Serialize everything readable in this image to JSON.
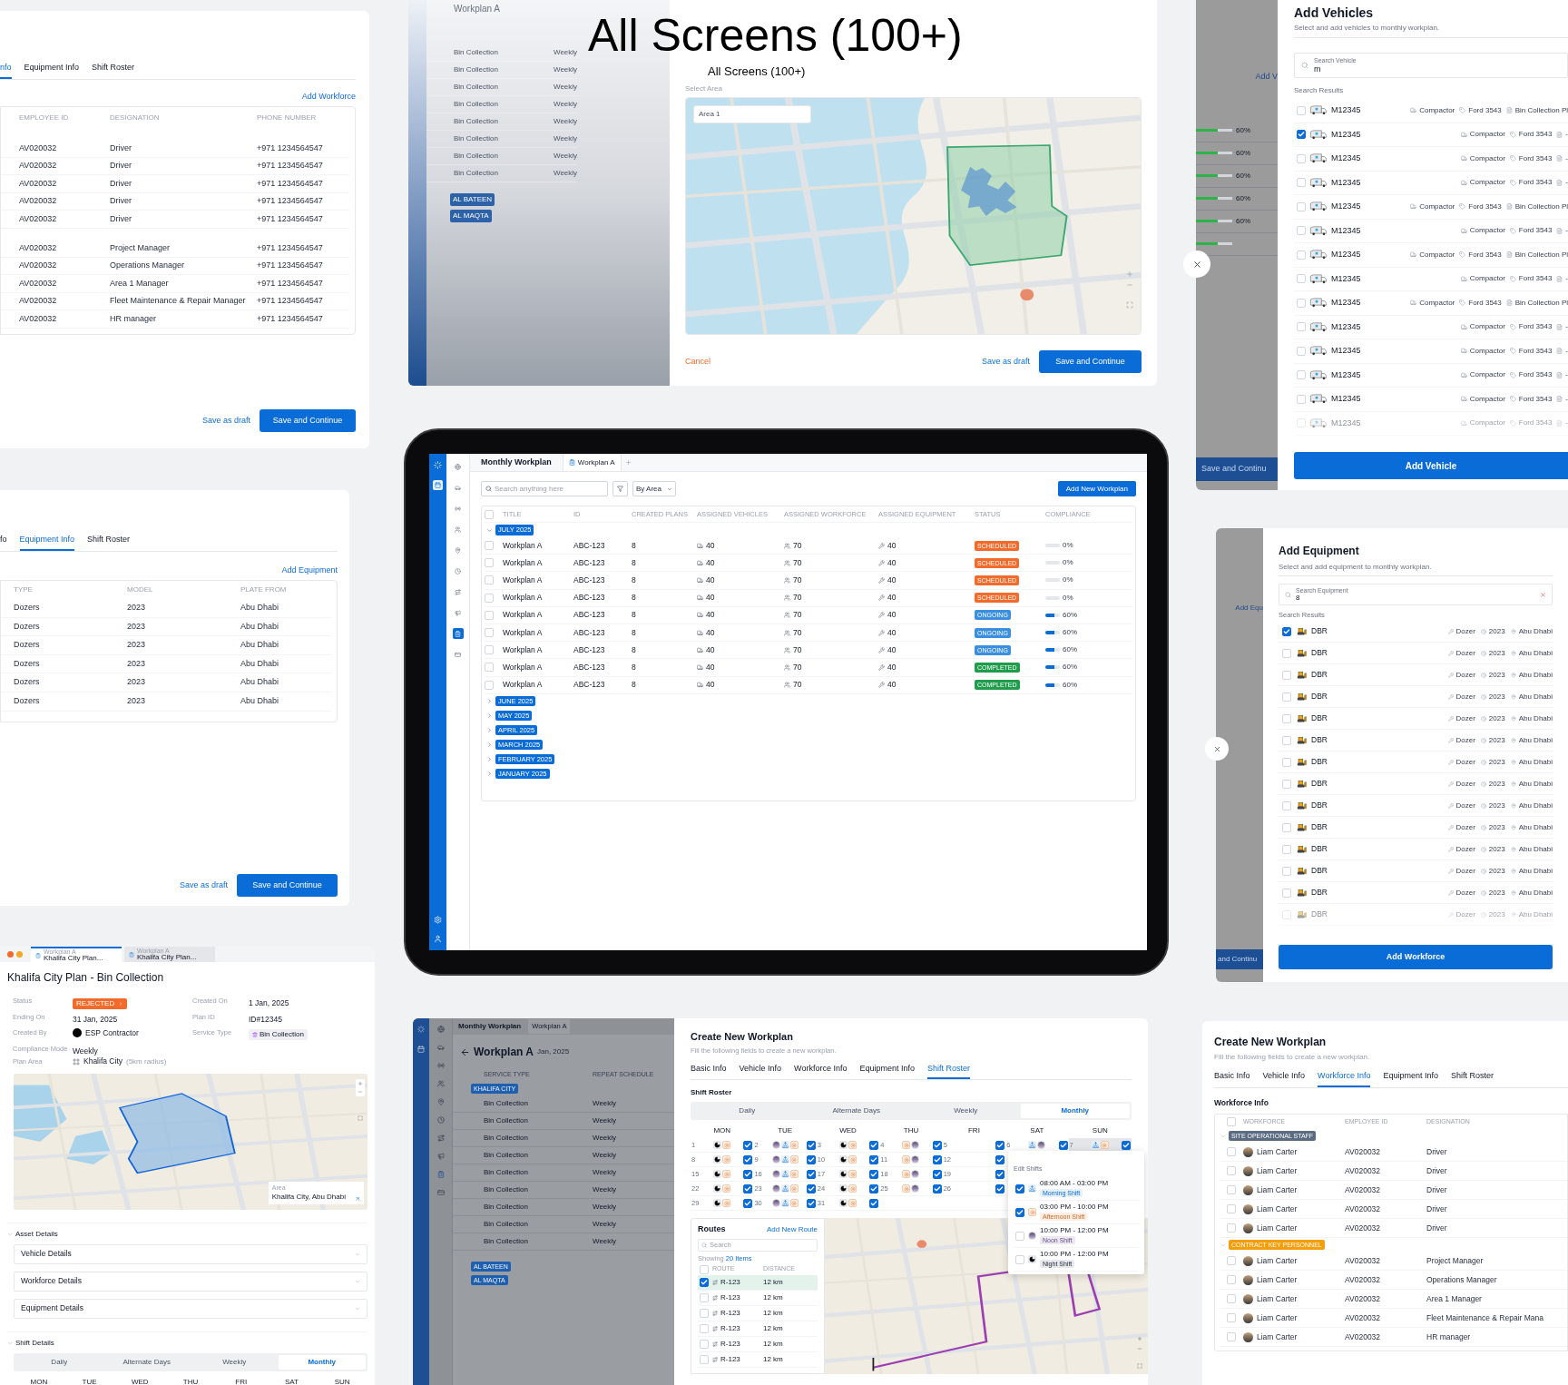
{
  "headline": {
    "title": "All Screens (100+)",
    "subtitle": "All Screens (100+)"
  },
  "workforce_table": {
    "tabs": [
      {
        "label": "nfo",
        "selected": true
      },
      {
        "label": "Equipment Info",
        "selected": false
      },
      {
        "label": "Shift Roster",
        "selected": false
      }
    ],
    "action": "Add Workforce",
    "columns": [
      "EMPLOYEE ID",
      "DESIGNATION",
      "PHONE NUMBER"
    ],
    "groups": [
      [
        {
          "id": "AV020032",
          "designation": "Driver",
          "phone": "+971 1234564547"
        },
        {
          "id": "AV020032",
          "designation": "Driver",
          "phone": "+971 1234564547"
        },
        {
          "id": "AV020032",
          "designation": "Driver",
          "phone": "+971 1234564547"
        },
        {
          "id": "AV020032",
          "designation": "Driver",
          "phone": "+971 1234564547"
        },
        {
          "id": "AV020032",
          "designation": "Driver",
          "phone": "+971 1234564547"
        }
      ],
      [
        {
          "id": "AV020032",
          "designation": "Project Manager",
          "phone": "+971 1234564547"
        },
        {
          "id": "AV020032",
          "designation": "Operations Manager",
          "phone": "+971 1234564547"
        },
        {
          "id": "AV020032",
          "designation": "Area 1 Manager",
          "phone": "+971 1234564547"
        },
        {
          "id": "AV020032",
          "designation": "Fleet Maintenance & Repair Manager",
          "phone": "+971 1234564547"
        },
        {
          "id": "AV020032",
          "designation": "HR manager",
          "phone": "+971 1234564547"
        }
      ]
    ],
    "draft": "Save as draft",
    "submit": "Save and Continue"
  },
  "area_screen": {
    "heading": "Workplan A",
    "list": [
      {
        "title": "Bin Collection",
        "frequency": "Weekly"
      },
      {
        "title": "Bin Collection",
        "frequency": "Weekly"
      },
      {
        "title": "Bin Collection",
        "frequency": "Weekly"
      },
      {
        "title": "Bin Collection",
        "frequency": "Weekly"
      },
      {
        "title": "Bin Collection",
        "frequency": "Weekly"
      },
      {
        "title": "Bin Collection",
        "frequency": "Weekly"
      },
      {
        "title": "Bin Collection",
        "frequency": "Weekly"
      },
      {
        "title": "Bin Collection",
        "frequency": "Weekly"
      }
    ],
    "groups": [
      "AL BATEEN",
      "AL MAQTA"
    ],
    "field_label": "Select Area",
    "field_value": "Area 1",
    "cancel": "Cancel",
    "draft": "Save as draft",
    "submit": "Save and Continue"
  },
  "add_vehicles": {
    "title": "Add Vehicles",
    "subtitle": "Select and add vehicles to monthly workplan.",
    "search": {
      "label": "Search Vehicle",
      "value": "m"
    },
    "results_label": "Search Results",
    "rows": [
      {
        "plate": "M12345",
        "checked": false,
        "faded": false,
        "type": "Compactor",
        "model": "Ford 3543",
        "plan": "Bin Collection Pl"
      },
      {
        "plate": "M12345",
        "checked": true,
        "faded": false,
        "type": "Compactor",
        "model": "Ford 3543",
        "plan": "-"
      },
      {
        "plate": "M12345",
        "checked": false,
        "faded": false,
        "type": "Compactor",
        "model": "Ford 3543",
        "plan": "-"
      },
      {
        "plate": "M12345",
        "checked": false,
        "faded": false,
        "type": "Compactor",
        "model": "Ford 3543",
        "plan": "-"
      },
      {
        "plate": "M12345",
        "checked": false,
        "faded": false,
        "type": "Compactor",
        "model": "Ford 3543",
        "plan": "Bin Collection Pl"
      },
      {
        "plate": "M12345",
        "checked": false,
        "faded": false,
        "type": "Compactor",
        "model": "Ford 3543",
        "plan": "-"
      },
      {
        "plate": "M12345",
        "checked": false,
        "faded": false,
        "type": "Compactor",
        "model": "Ford 3543",
        "plan": "Bin Collection Pl"
      },
      {
        "plate": "M12345",
        "checked": false,
        "faded": false,
        "type": "Compactor",
        "model": "Ford 3543",
        "plan": "-"
      },
      {
        "plate": "M12345",
        "checked": false,
        "faded": false,
        "type": "Compactor",
        "model": "Ford 3543",
        "plan": "Bin Collection Pl"
      },
      {
        "plate": "M12345",
        "checked": false,
        "faded": false,
        "type": "Compactor",
        "model": "Ford 3543",
        "plan": "-"
      },
      {
        "plate": "M12345",
        "checked": false,
        "faded": false,
        "type": "Compactor",
        "model": "Ford 3543",
        "plan": "-"
      },
      {
        "plate": "M12345",
        "checked": false,
        "faded": false,
        "type": "Compactor",
        "model": "Ford 3543",
        "plan": "-"
      },
      {
        "plate": "M12345",
        "checked": false,
        "faded": false,
        "type": "Compactor",
        "model": "Ford 3543",
        "plan": "-"
      },
      {
        "plate": "M12345",
        "checked": false,
        "faded": true,
        "type": "Compactor",
        "model": "Ford 3543",
        "plan": "-"
      }
    ],
    "button": "Add Vehicle",
    "behind": {
      "link": "Add V",
      "bars": [
        {
          "level": 0.6,
          "reading": "60%"
        },
        {
          "level": 0.6,
          "reading": "60%"
        },
        {
          "level": 0.6,
          "reading": "60%"
        },
        {
          "level": 0.6,
          "reading": "60%"
        },
        {
          "level": 0.6,
          "reading": "60%"
        },
        {
          "level": 0.6
        }
      ],
      "button": "Save and Continu"
    }
  },
  "equipment_table": {
    "tabs": [
      {
        "label": "fo",
        "selected": false
      },
      {
        "label": "Equipment Info",
        "selected": true
      },
      {
        "label": "Shift Roster",
        "selected": false
      }
    ],
    "action": "Add Equipment",
    "columns": [
      "TYPE",
      "MODEL",
      "PLATE FROM"
    ],
    "rows": [
      {
        "type": "Dozers",
        "model": "2023",
        "plate": "Abu Dhabi"
      },
      {
        "type": "Dozers",
        "model": "2023",
        "plate": "Abu Dhabi"
      },
      {
        "type": "Dozers",
        "model": "2023",
        "plate": "Abu Dhabi"
      },
      {
        "type": "Dozers",
        "model": "2023",
        "plate": "Abu Dhabi"
      },
      {
        "type": "Dozers",
        "model": "2023",
        "plate": "Abu Dhabi"
      },
      {
        "type": "Dozers",
        "model": "2023",
        "plate": "Abu Dhabi"
      }
    ],
    "draft": "Save as draft",
    "submit": "Save and Continue"
  },
  "tablet": {
    "tabs": [
      {
        "label": "Monthly Workplan",
        "selected": false
      },
      {
        "label": "Workplan A",
        "selected": true
      }
    ],
    "search_placeholder": "Search anything here",
    "filter": "By Area",
    "button": "Add New Workplan",
    "all_checked": false,
    "columns": [
      "TITLE",
      "ID",
      "CREATED PLANS",
      "ASSIGNED VEHICLES",
      "ASSIGNED WORKFORCE",
      "ASSIGNED EQUIPMENT",
      "STATUS",
      "COMPLIANCE"
    ],
    "groups": [
      {
        "label": "JULY 2025",
        "expanded": true,
        "rows": [
          {
            "checked": false,
            "title": "Workplan A",
            "id": "ABC-123",
            "plans": "8",
            "vehicles": "40",
            "workforce": "70",
            "equipment": "40",
            "status": "SCHEDULED",
            "kind": "scheduled",
            "compliance": "0%",
            "level": 0
          },
          {
            "checked": false,
            "title": "Workplan A",
            "id": "ABC-123",
            "plans": "8",
            "vehicles": "40",
            "workforce": "70",
            "equipment": "40",
            "status": "SCHEDULED",
            "kind": "scheduled",
            "compliance": "0%",
            "level": 0
          },
          {
            "checked": false,
            "title": "Workplan A",
            "id": "ABC-123",
            "plans": "8",
            "vehicles": "40",
            "workforce": "70",
            "equipment": "40",
            "status": "SCHEDULED",
            "kind": "scheduled",
            "compliance": "0%",
            "level": 0
          },
          {
            "checked": false,
            "title": "Workplan A",
            "id": "ABC-123",
            "plans": "8",
            "vehicles": "40",
            "workforce": "70",
            "equipment": "40",
            "status": "SCHEDULED",
            "kind": "scheduled",
            "compliance": "0%",
            "level": 0
          },
          {
            "checked": false,
            "title": "Workplan A",
            "id": "ABC-123",
            "plans": "8",
            "vehicles": "40",
            "workforce": "70",
            "equipment": "40",
            "status": "ONGOING",
            "kind": "ongoing",
            "compliance": "60%",
            "level": 0.6
          },
          {
            "checked": false,
            "title": "Workplan A",
            "id": "ABC-123",
            "plans": "8",
            "vehicles": "40",
            "workforce": "70",
            "equipment": "40",
            "status": "ONGOING",
            "kind": "ongoing",
            "compliance": "60%",
            "level": 0.6
          },
          {
            "checked": false,
            "title": "Workplan A",
            "id": "ABC-123",
            "plans": "8",
            "vehicles": "40",
            "workforce": "70",
            "equipment": "40",
            "status": "ONGOING",
            "kind": "ongoing",
            "compliance": "60%",
            "level": 0.6
          },
          {
            "checked": false,
            "title": "Workplan A",
            "id": "ABC-123",
            "plans": "8",
            "vehicles": "40",
            "workforce": "70",
            "equipment": "40",
            "status": "COMPLETED",
            "kind": "completed",
            "compliance": "60%",
            "level": 0.6
          },
          {
            "checked": false,
            "title": "Workplan A",
            "id": "ABC-123",
            "plans": "8",
            "vehicles": "40",
            "workforce": "70",
            "equipment": "40",
            "status": "COMPLETED",
            "kind": "completed",
            "compliance": "60%",
            "level": 0.6
          }
        ]
      },
      {
        "label": "JUNE 2025",
        "expanded": false
      },
      {
        "label": "MAY 2025",
        "expanded": false
      },
      {
        "label": "APRIL 2025",
        "expanded": false
      },
      {
        "label": "MARCH 2025",
        "expanded": false
      },
      {
        "label": "FEBRUARY 2025",
        "expanded": false
      },
      {
        "label": "JANUARY 2025",
        "expanded": false
      }
    ]
  },
  "add_equipment": {
    "title": "Add Equipment",
    "subtitle": "Select and add equipment to monthly workplan.",
    "search": {
      "label": "Search Equipment",
      "value": "8"
    },
    "results_label": "Search Results",
    "rows": [
      {
        "name": "DBR",
        "checked": true,
        "faded": false,
        "type": "Dozer",
        "model": "2023",
        "location": "Abu Dhabi"
      },
      {
        "name": "DBR",
        "checked": false,
        "faded": false,
        "type": "Dozer",
        "model": "2023",
        "location": "Abu Dhabi"
      },
      {
        "name": "DBR",
        "checked": false,
        "faded": false,
        "type": "Dozer",
        "model": "2023",
        "location": "Abu Dhabi"
      },
      {
        "name": "DBR",
        "checked": false,
        "faded": false,
        "type": "Dozer",
        "model": "2023",
        "location": "Abu Dhabi"
      },
      {
        "name": "DBR",
        "checked": false,
        "faded": false,
        "type": "Dozer",
        "model": "2023",
        "location": "Abu Dhabi"
      },
      {
        "name": "DBR",
        "checked": false,
        "faded": false,
        "type": "Dozer",
        "model": "2023",
        "location": "Abu Dhabi"
      },
      {
        "name": "DBR",
        "checked": false,
        "faded": false,
        "type": "Dozer",
        "model": "2023",
        "location": "Abu Dhabi"
      },
      {
        "name": "DBR",
        "checked": false,
        "faded": false,
        "type": "Dozer",
        "model": "2023",
        "location": "Abu Dhabi"
      },
      {
        "name": "DBR",
        "checked": false,
        "faded": false,
        "type": "Dozer",
        "model": "2023",
        "location": "Abu Dhabi"
      },
      {
        "name": "DBR",
        "checked": false,
        "faded": false,
        "type": "Dozer",
        "model": "2023",
        "location": "Abu Dhabi"
      },
      {
        "name": "DBR",
        "checked": false,
        "faded": false,
        "type": "Dozer",
        "model": "2023",
        "location": "Abu Dhabi"
      },
      {
        "name": "DBR",
        "checked": false,
        "faded": false,
        "type": "Dozer",
        "model": "2023",
        "location": "Abu Dhabi"
      },
      {
        "name": "DBR",
        "checked": false,
        "faded": false,
        "type": "Dozer",
        "model": "2023",
        "location": "Abu Dhabi"
      },
      {
        "name": "DBR",
        "checked": false,
        "faded": true,
        "type": "Dozer",
        "model": "2023",
        "location": "Abu Dhabi"
      }
    ],
    "button": "Add Workforce",
    "behind": {
      "link": "Add Equ",
      "button": "and Continu"
    }
  },
  "plan_detail": {
    "window_tabs": [
      {
        "caption": "Workplan A",
        "label": "Khalifa City Plan...",
        "selected": true
      },
      {
        "caption": "Workplan A",
        "label": "Khalifa City Plan...",
        "selected": false
      }
    ],
    "title": "Khalifa City Plan - Bin Collection",
    "field_rows": [
      [
        {
          "label": "Status",
          "kind": "badge",
          "value": "REJECTED"
        },
        {
          "label": "Created On",
          "kind": "text",
          "value": "1 Jan, 2025"
        }
      ],
      [
        {
          "label": "Ending On",
          "kind": "text",
          "value": "31 Jan, 2025"
        },
        {
          "label": "Plan ID",
          "kind": "text",
          "value": "ID#12345"
        }
      ],
      [
        {
          "label": "Created By",
          "kind": "avatar",
          "value": "ESP Contractor"
        },
        {
          "label": "Service Type",
          "kind": "tag",
          "value": "Bin Collection"
        }
      ],
      [
        {
          "label": "Compliance Mode",
          "kind": "text",
          "value": "Weekly"
        }
      ],
      [
        {
          "label": "Plan Area",
          "kind": "area",
          "value": "Khalifa City",
          "note": "(5km radius)"
        }
      ]
    ],
    "map_card": {
      "label": "Area",
      "value": "Khalifa City, Abu Dhabi"
    },
    "asset_section": "Asset Details",
    "accordions": [
      "Vehicle Details",
      "Workforce Details",
      "Equipment Details"
    ],
    "shift_section": "Shift Details",
    "frequency": [
      {
        "label": "Daily",
        "selected": false
      },
      {
        "label": "Alternate Days",
        "selected": false
      },
      {
        "label": "Weekly",
        "selected": false
      },
      {
        "label": "Monthly",
        "selected": true
      }
    ],
    "days": [
      "MON",
      "TUE",
      "WED",
      "THU",
      "FRI",
      "SAT",
      "SUN"
    ]
  },
  "roster_screen": {
    "back": {
      "tab": "Monthly Workplan",
      "subtab": "Workplan A",
      "title": "Workplan A",
      "date": "Jan, 2025",
      "columns": [
        "SERVICE TYPE",
        "REPEAT SCHEDULE"
      ],
      "group": "KHALIFA CITY",
      "rows": [
        {
          "title": "Bin Collection",
          "frequency": "Weekly"
        },
        {
          "title": "Bin Collection",
          "frequency": "Weekly"
        },
        {
          "title": "Bin Collection",
          "frequency": "Weekly"
        },
        {
          "title": "Bin Collection",
          "frequency": "Weekly"
        },
        {
          "title": "Bin Collection",
          "frequency": "Weekly"
        },
        {
          "title": "Bin Collection",
          "frequency": "Weekly"
        },
        {
          "title": "Bin Collection",
          "frequency": "Weekly"
        },
        {
          "title": "Bin Collection",
          "frequency": "Weekly"
        },
        {
          "title": "Bin Collection",
          "frequency": "Weekly"
        }
      ],
      "groups": [
        "AL BATEEN",
        "AL MAQTA"
      ]
    },
    "title": "Create New Workplan",
    "subtitle": "Fill the following fields to create a new workplan.",
    "tabs": [
      {
        "label": "Basic Info",
        "selected": false
      },
      {
        "label": "Vehicle Info",
        "selected": false
      },
      {
        "label": "Workforce Info",
        "selected": false
      },
      {
        "label": "Equipment Info",
        "selected": false
      },
      {
        "label": "Shift Roster",
        "selected": true
      }
    ],
    "section": "Shift Roster",
    "frequency": [
      {
        "label": "Daily",
        "selected": false
      },
      {
        "label": "Alternate Days",
        "selected": false
      },
      {
        "label": "Weekly",
        "selected": false
      },
      {
        "label": "Monthly",
        "selected": true
      }
    ],
    "days": [
      "MON",
      "TUE",
      "WED",
      "THU",
      "FRI",
      "SAT",
      "SUN"
    ],
    "weeks": [
      [
        {
          "date": "1",
          "shifts": [
            {
              "kind": "night"
            },
            {
              "kind": "day"
            }
          ],
          "checked": true,
          "selected": false
        },
        {
          "date": "2",
          "shifts": [
            {
              "kind": "evening"
            },
            {
              "kind": "morning"
            },
            {
              "kind": "day"
            }
          ],
          "checked": true,
          "selected": false
        },
        {
          "date": "3",
          "shifts": [
            {
              "kind": "night"
            },
            {
              "kind": "day"
            }
          ],
          "checked": true,
          "selected": false
        },
        {
          "date": "4",
          "shifts": [
            {
              "kind": "day"
            },
            {
              "kind": "evening"
            }
          ],
          "checked": true,
          "selected": false
        },
        {
          "date": "5",
          "checked": true,
          "selected": false
        },
        {
          "date": "6",
          "shifts": [
            {
              "kind": "morning"
            },
            {
              "kind": "evening"
            }
          ],
          "checked": true,
          "selected": false
        },
        {
          "date": "7",
          "shifts": [
            {
              "kind": "morning"
            },
            {
              "kind": "day"
            }
          ],
          "checked": true,
          "selected": true
        }
      ],
      [
        {
          "date": "8",
          "shifts": [
            {
              "kind": "night"
            },
            {
              "kind": "day"
            }
          ],
          "checked": true,
          "selected": false
        },
        {
          "date": "9",
          "shifts": [
            {
              "kind": "evening"
            },
            {
              "kind": "morning"
            },
            {
              "kind": "day"
            }
          ],
          "checked": true,
          "selected": false
        },
        {
          "date": "10",
          "shifts": [
            {
              "kind": "night"
            },
            {
              "kind": "day"
            }
          ],
          "checked": true,
          "selected": false
        },
        {
          "date": "11",
          "shifts": [
            {
              "kind": "day"
            },
            {
              "kind": "evening"
            }
          ],
          "checked": true,
          "selected": false
        },
        {
          "date": "12",
          "checked": true,
          "selected": false
        }
      ],
      [
        {
          "date": "15",
          "shifts": [
            {
              "kind": "night"
            },
            {
              "kind": "day"
            }
          ],
          "checked": true,
          "selected": false
        },
        {
          "date": "16",
          "shifts": [
            {
              "kind": "evening"
            },
            {
              "kind": "morning"
            },
            {
              "kind": "day"
            }
          ],
          "checked": true,
          "selected": false
        },
        {
          "date": "17",
          "shifts": [
            {
              "kind": "night"
            },
            {
              "kind": "day"
            }
          ],
          "checked": true,
          "selected": false
        },
        {
          "date": "18",
          "shifts": [
            {
              "kind": "day"
            },
            {
              "kind": "evening"
            }
          ],
          "checked": true,
          "selected": false
        },
        {
          "date": "19",
          "checked": true,
          "selected": false
        }
      ],
      [
        {
          "date": "22",
          "shifts": [
            {
              "kind": "night"
            },
            {
              "kind": "day"
            }
          ],
          "checked": true,
          "selected": false
        },
        {
          "date": "23",
          "shifts": [
            {
              "kind": "evening"
            },
            {
              "kind": "morning"
            },
            {
              "kind": "day"
            }
          ],
          "checked": true,
          "selected": false
        },
        {
          "date": "24",
          "shifts": [
            {
              "kind": "night"
            },
            {
              "kind": "day"
            }
          ],
          "checked": true,
          "selected": false
        },
        {
          "date": "25",
          "shifts": [
            {
              "kind": "day"
            },
            {
              "kind": "evening"
            }
          ],
          "checked": true,
          "selected": false
        },
        {
          "date": "26",
          "checked": true,
          "selected": false
        }
      ],
      [
        {
          "date": "29",
          "shifts": [
            {
              "kind": "night"
            },
            {
              "kind": "day"
            }
          ],
          "checked": true,
          "selected": false
        },
        {
          "date": "30",
          "shifts": [
            {
              "kind": "evening"
            },
            {
              "kind": "morning"
            },
            {
              "kind": "day"
            }
          ],
          "checked": true,
          "selected": false
        },
        {
          "date": "31",
          "shifts": [
            {
              "kind": "night"
            },
            {
              "kind": "day"
            }
          ],
          "checked": true,
          "selected": false
        }
      ]
    ],
    "popup": {
      "title": "Edit Shifts",
      "shifts": [
        {
          "checked": true,
          "kind": "morning",
          "time": "08:00 AM - 03:00 PM",
          "name": "Morning Shift"
        },
        {
          "checked": true,
          "kind": "day",
          "time": "03:00 PM - 10:00 PM",
          "name": "Afternoon Shift"
        },
        {
          "checked": false,
          "kind": "evening",
          "time": "10:00 PM - 12:00 PM",
          "name": "Noon Shift"
        },
        {
          "checked": false,
          "kind": "night",
          "time": "10:00 PM - 12:00 PM",
          "name": "Night Shift"
        }
      ]
    },
    "routes": {
      "title": "Routes",
      "action": "Add New Route",
      "search": "Search",
      "showing": "Showing",
      "count": "20 Items",
      "all_checked": false,
      "columns": [
        "ROUTE",
        "DISTANCE"
      ],
      "rows": [
        {
          "checked": true,
          "name": "R-123",
          "distance": "12 km"
        },
        {
          "checked": false,
          "name": "R-123",
          "distance": "12 km"
        },
        {
          "checked": false,
          "name": "R-123",
          "distance": "12 km"
        },
        {
          "checked": false,
          "name": "R-123",
          "distance": "12 km"
        },
        {
          "checked": false,
          "name": "R-123",
          "distance": "12 km"
        },
        {
          "checked": false,
          "name": "R-123",
          "distance": "12 km"
        }
      ]
    }
  },
  "workforce_form": {
    "title": "Create New Workplan",
    "subtitle": "Fill the following fields to create a new workplan.",
    "tabs": [
      {
        "label": "Basic Info",
        "selected": false
      },
      {
        "label": "Vehicle Info",
        "selected": false
      },
      {
        "label": "Workforce Info",
        "selected": true
      },
      {
        "label": "Equipment Info",
        "selected": false
      },
      {
        "label": "Shift Roster",
        "selected": false
      }
    ],
    "section": "Workforce Info",
    "all_checked": false,
    "columns": [
      "WORKFORCE",
      "EMPLOYEE ID",
      "DESIGNATION"
    ],
    "groups": [
      {
        "label": "SITE OPERATIONAL STAFF",
        "color": "#5b6b82",
        "rows": [
          {
            "checked": false,
            "name": "Liam Carter",
            "id": "AV020032",
            "designation": "Driver"
          },
          {
            "checked": false,
            "name": "Liam Carter",
            "id": "AV020032",
            "designation": "Driver"
          },
          {
            "checked": false,
            "name": "Liam Carter",
            "id": "AV020032",
            "designation": "Driver"
          },
          {
            "checked": false,
            "name": "Liam Carter",
            "id": "AV020032",
            "designation": "Driver"
          },
          {
            "checked": false,
            "name": "Liam Carter",
            "id": "AV020032",
            "designation": "Driver"
          }
        ]
      },
      {
        "label": "CONTRACT KEY PERSONNEL",
        "color": "#f59e0b",
        "rows": [
          {
            "checked": false,
            "name": "Liam Carter",
            "id": "AV020032",
            "designation": "Project Manager"
          },
          {
            "checked": false,
            "name": "Liam Carter",
            "id": "AV020032",
            "designation": "Operations Manager"
          },
          {
            "checked": false,
            "name": "Liam Carter",
            "id": "AV020032",
            "designation": "Area 1 Manager"
          },
          {
            "checked": false,
            "name": "Liam Carter",
            "id": "AV020032",
            "designation": "Fleet Maintenance & Repair Mana"
          },
          {
            "checked": false,
            "name": "Liam Carter",
            "id": "AV020032",
            "designation": "HR manager"
          }
        ]
      }
    ]
  }
}
